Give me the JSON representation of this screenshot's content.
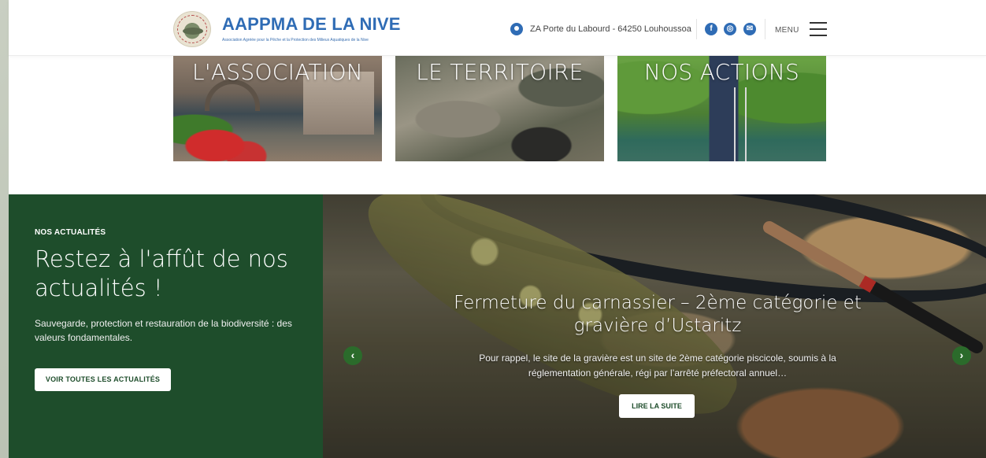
{
  "header": {
    "site_title": "AAPPMA DE LA NIVE",
    "site_subtitle": "Association Agréée pour la Pêche et la Protection des Milieux Aquatiques de la Nive",
    "address": "ZA Porte du Labourd - 64250 Louhoussoa",
    "menu_label": "MENU",
    "social": [
      {
        "icon": "facebook-icon",
        "glyph": "f"
      },
      {
        "icon": "instagram-icon",
        "glyph": "◎"
      },
      {
        "icon": "email-icon",
        "glyph": "✉"
      }
    ],
    "brand_color": "#2f6cb5"
  },
  "tiles": [
    {
      "label": "L'ASSOCIATION"
    },
    {
      "label": "LE TERRITOIRE"
    },
    {
      "label": "NOS ACTIONS"
    }
  ],
  "news": {
    "kicker": "NOS ACTUALITÉS",
    "title": "Restez à l'affût de nos actualités !",
    "description": "Sauvegarde, protection et restauration de la biodiversité : des valeurs fondamentales.",
    "button_label": "VOIR TOUTES LES ACTUALITÉS",
    "panel_color": "#1e4d2b"
  },
  "slider": {
    "slide_title": "Fermeture du carnassier – 2ème catégorie et gravière d’Ustaritz",
    "slide_excerpt": "Pour rappel, le site de la gravière est un site de 2ème catégorie piscicole, soumis à la réglementation générale, régi par l’arrêté préfectoral annuel…",
    "button_label": "LIRE LA SUITE",
    "prev_glyph": "‹",
    "next_glyph": "›"
  }
}
